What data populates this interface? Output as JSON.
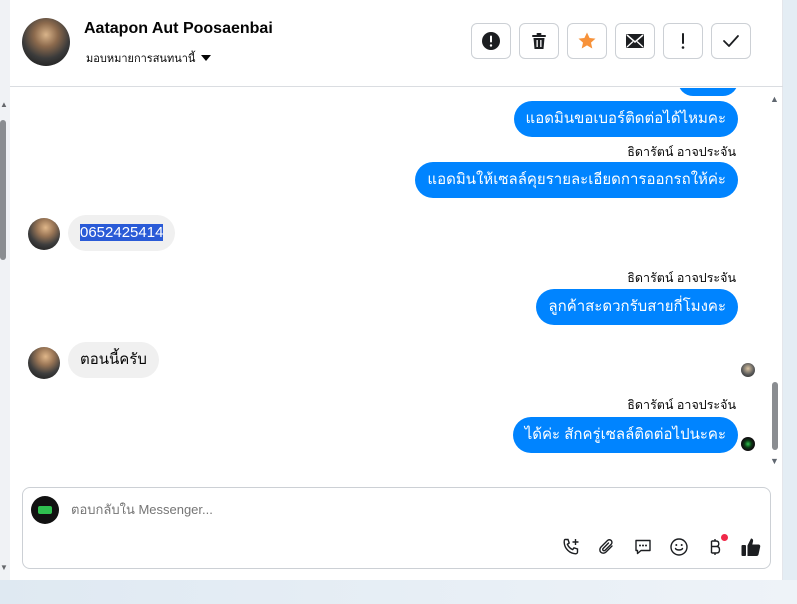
{
  "header": {
    "contact_name": "Aatapon Aut Poosaenbai",
    "assign_label": "มอบหมายการสนทนานี้",
    "actions": [
      {
        "icon": "alert-circle-icon",
        "name": "mark-spam-button"
      },
      {
        "icon": "trash-icon",
        "name": "delete-button"
      },
      {
        "icon": "star-icon",
        "name": "star-button"
      },
      {
        "icon": "envelope-icon",
        "name": "mark-unread-button"
      },
      {
        "icon": "exclamation-icon",
        "name": "follow-up-button"
      },
      {
        "icon": "check-icon",
        "name": "mark-done-button"
      }
    ]
  },
  "messages": {
    "m1": "แอดมินขอเบอร์ติดต่อได้ไหมคะ",
    "sender1": "ธิดารัตน์ อาจประจัน",
    "m2": "แอดมินให้เซลล์คุยรายละเอียดการออกรถให้ค่ะ",
    "m3": "0652425414",
    "sender2": "ธิดารัตน์ อาจประจัน",
    "m4": "ลูกค้าสะดวกรับสายกี่โมงคะ",
    "m5": "ตอนนี้ครับ",
    "sender3": "ธิดารัตน์ อาจประจัน",
    "m6": "ได้ค่ะ สักครู่เซลล์ติดต่อไปนะคะ"
  },
  "composer": {
    "placeholder": "ตอบกลับใน Messenger..."
  },
  "colors": {
    "outgoing_bubble": "#0084ff",
    "incoming_bubble": "#f0f0f0",
    "star": "#f7923a",
    "notification": "#f02849"
  }
}
